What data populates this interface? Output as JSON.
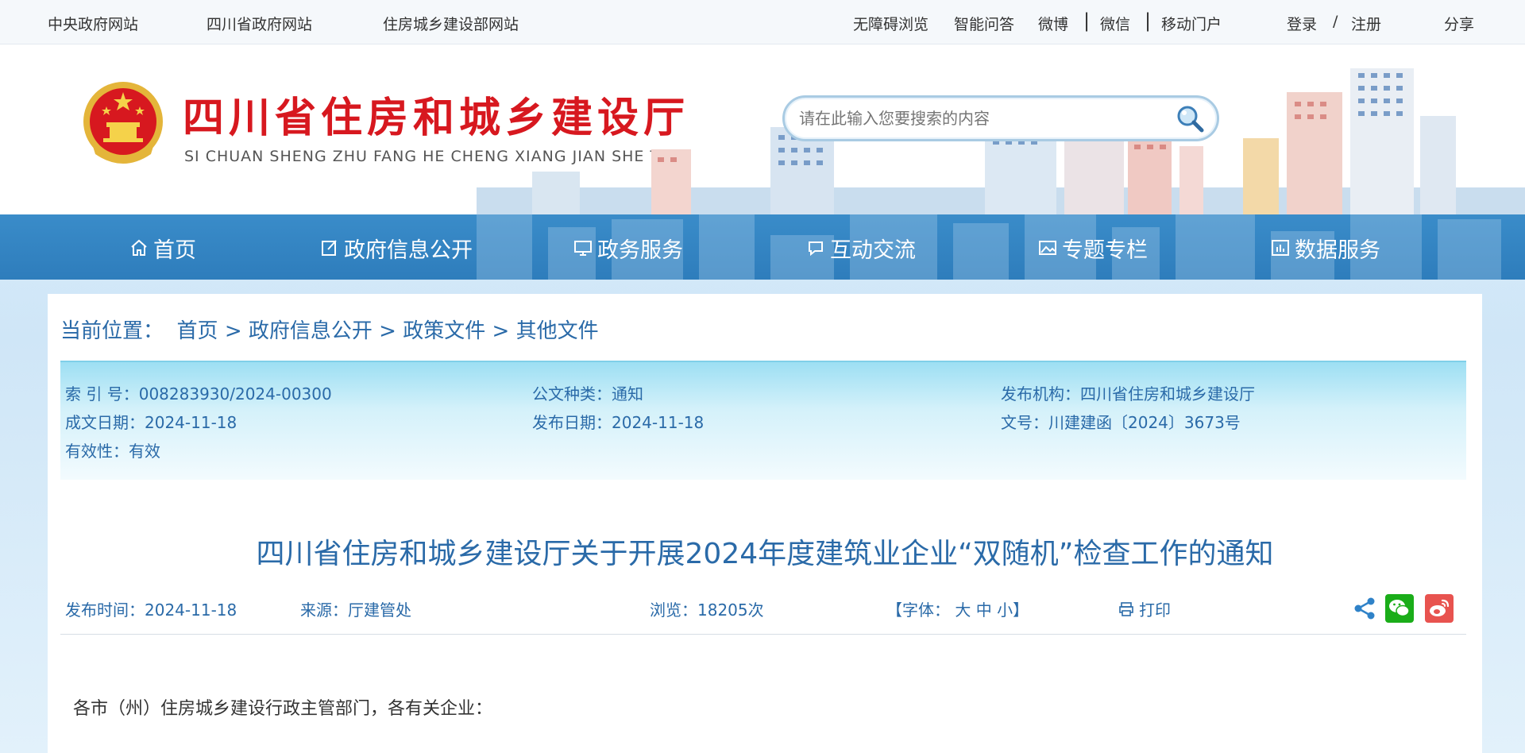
{
  "topbar": {
    "left_links": [
      "中央政府网站",
      "四川省政府网站",
      "住房城乡建设部网站"
    ],
    "accessibility": "无障碍浏览",
    "qa": "智能问答",
    "weibo": "微博",
    "wechat": "微信",
    "mobile": "移动门户",
    "login": "登录",
    "slash": "/",
    "register": "注册",
    "share": "分享"
  },
  "header": {
    "title": "四川省住房和城乡建设厅",
    "subtitle": "SI CHUAN SHENG ZHU FANG HE CHENG XIANG JIAN SHE TING",
    "search_placeholder": "请在此输入您要搜索的内容"
  },
  "nav": {
    "items": [
      {
        "label": "首页",
        "icon": "home-icon"
      },
      {
        "label": "政府信息公开",
        "icon": "edit-icon"
      },
      {
        "label": "政务服务",
        "icon": "monitor-icon"
      },
      {
        "label": "互动交流",
        "icon": "chat-icon"
      },
      {
        "label": "专题专栏",
        "icon": "image-icon"
      },
      {
        "label": "数据服务",
        "icon": "chart-icon"
      }
    ]
  },
  "breadcrumb": {
    "label": "当前位置：",
    "items": [
      "首页",
      "政府信息公开",
      "政策文件",
      "其他文件"
    ],
    "sep": ">"
  },
  "meta": {
    "index_label": "索 引 号：",
    "index_value": "008283930/2024-00300",
    "type_label": "公文种类：",
    "type_value": "通知",
    "issuer_label": "发布机构：",
    "issuer_value": "四川省住房和城乡建设厅",
    "written_label": "成文日期：",
    "written_value": "2024-11-18",
    "publish_label": "发布日期：",
    "publish_value": "2024-11-18",
    "docno_label": "文号：",
    "docno_value": "川建建函〔2024〕3673号",
    "validity_label": "有效性：",
    "validity_value": "有效"
  },
  "article": {
    "title": "四川省住房和城乡建设厅关于开展2024年度建筑业企业“双随机”检查工作的通知",
    "time_label": "发布时间：",
    "time_value": "2024-11-18",
    "source_label": "来源：",
    "source_value": "厅建管处",
    "views_label": "浏览：",
    "views_value": "18205次",
    "font_label": "【字体：",
    "font_large": "大",
    "font_medium": "中",
    "font_small": "小",
    "font_end": "】",
    "print": "打印",
    "salutation": "各市（州）住房城乡建设行政主管部门，各有关企业："
  },
  "colors": {
    "brand_red": "#d7181f",
    "nav_blue": "#2e7dbc",
    "link_blue": "#2a6aa8",
    "wechat_green": "#1aad19",
    "weibo_red": "#e8534f"
  }
}
